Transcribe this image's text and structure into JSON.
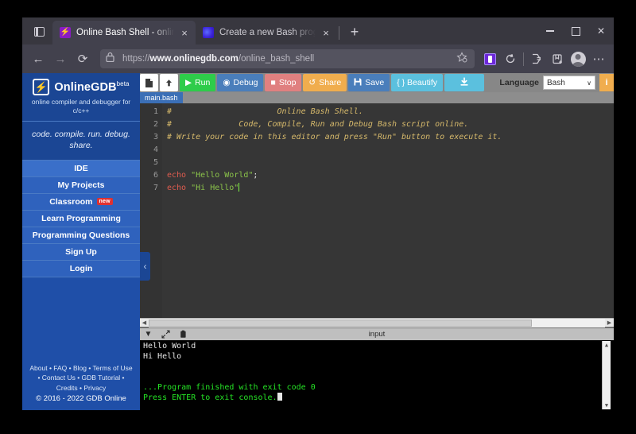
{
  "browser": {
    "tabs": [
      {
        "title": "Online Bash Shell - online",
        "favicon": "gdb-bolt-icon",
        "active": true,
        "close": "×"
      },
      {
        "title": "Create a new Bash progra",
        "favicon": "blue-orb-icon",
        "active": false,
        "close": "×"
      }
    ],
    "new_tab_label": "+",
    "list_all_tabs_label": "",
    "window_controls": {
      "minimize": "",
      "maximize": "",
      "close": "✕"
    },
    "nav": {
      "back": "←",
      "forward": "→",
      "reload": "⟳"
    },
    "url": {
      "scheme": "https://",
      "host": "www.onlinegdb.com",
      "path": "/online_bash_shell"
    },
    "toolbar_icons": [
      "shield-extension-icon",
      "container-tabs-icon",
      "save-to-pocket-icon",
      "account-avatar-icon",
      "more-menu-icon"
    ],
    "more_menu_label": "⋯"
  },
  "sidebar": {
    "brand": {
      "name": "OnlineGDB",
      "beta": "beta",
      "logo": "⚡",
      "subtitle": "online compiler and debugger for c/c++"
    },
    "tagline": "code. compile. run. debug. share.",
    "items": [
      {
        "label": "IDE",
        "selected": true,
        "badge": ""
      },
      {
        "label": "My Projects",
        "selected": false,
        "badge": ""
      },
      {
        "label": "Classroom",
        "selected": false,
        "badge": "new"
      },
      {
        "label": "Learn Programming",
        "selected": false,
        "badge": ""
      },
      {
        "label": "Programming Questions",
        "selected": false,
        "badge": ""
      },
      {
        "label": "Sign Up",
        "selected": false,
        "badge": ""
      },
      {
        "label": "Login",
        "selected": false,
        "badge": ""
      }
    ],
    "collapse_handle": "‹",
    "footer": {
      "line1": "About • FAQ • Blog • Terms of Use",
      "line2": "• Contact Us • GDB Tutorial •",
      "line3": "Credits • Privacy",
      "copyright": "© 2016 - 2022 GDB Online"
    }
  },
  "ide": {
    "toolbar": {
      "new_file_icon": "🗋",
      "upload_icon": "⬆",
      "run": "Run",
      "run_icon": "▶",
      "debug": "Debug",
      "debug_icon": "◉",
      "stop": "Stop",
      "stop_icon": "■",
      "share": "Share",
      "share_icon": "↺",
      "save": "Save",
      "save_icon": "💾",
      "beautify": "{ } Beautify",
      "download_icon": "⬇",
      "language_label": "Language",
      "language_value": "Bash",
      "language_caret": "∨",
      "help_icon": "i"
    },
    "file_tab": "main.bash",
    "editor": {
      "line_numbers": [
        "1",
        "2",
        "3",
        "4",
        "5",
        "6",
        "7"
      ],
      "lines": [
        {
          "type": "comment",
          "text": "#                      Online Bash Shell."
        },
        {
          "type": "comment",
          "text": "#              Code, Compile, Run and Debug Bash script online."
        },
        {
          "type": "comment",
          "text": "# Write your code in this editor and press \"Run\" button to execute it."
        },
        {
          "type": "blank",
          "text": ""
        },
        {
          "type": "blank",
          "text": ""
        },
        {
          "type": "code",
          "keyword": "echo",
          "string": " \"Hello World\"",
          "tail": ";"
        },
        {
          "type": "code",
          "keyword": "echo",
          "string": " \"Hi Hello\"",
          "tail": "",
          "cursor": true
        }
      ]
    },
    "console": {
      "title": "input",
      "icons": [
        "collapse-chevron-icon",
        "expand-arrows-icon",
        "copy-clipboard-icon"
      ],
      "lines": [
        {
          "text": "Hello World",
          "color": "white"
        },
        {
          "text": "Hi Hello",
          "color": "white"
        },
        {
          "text": "",
          "color": "white"
        },
        {
          "text": "",
          "color": "white"
        },
        {
          "text": "...Program finished with exit code 0",
          "color": "green"
        },
        {
          "text": "Press ENTER to exit console.",
          "color": "green",
          "cursor": true
        }
      ]
    }
  },
  "colors": {
    "sidebar_blue": "#1f4fa8",
    "run_green": "#2ecc4a",
    "debug_blue": "#4a7ebb",
    "stop_red": "#e08080",
    "share_orange": "#f0ad4e",
    "beautify_cyan": "#5bc0de",
    "console_green": "#25e425",
    "editor_bg": "#363636",
    "badge_red": "#e03131"
  }
}
